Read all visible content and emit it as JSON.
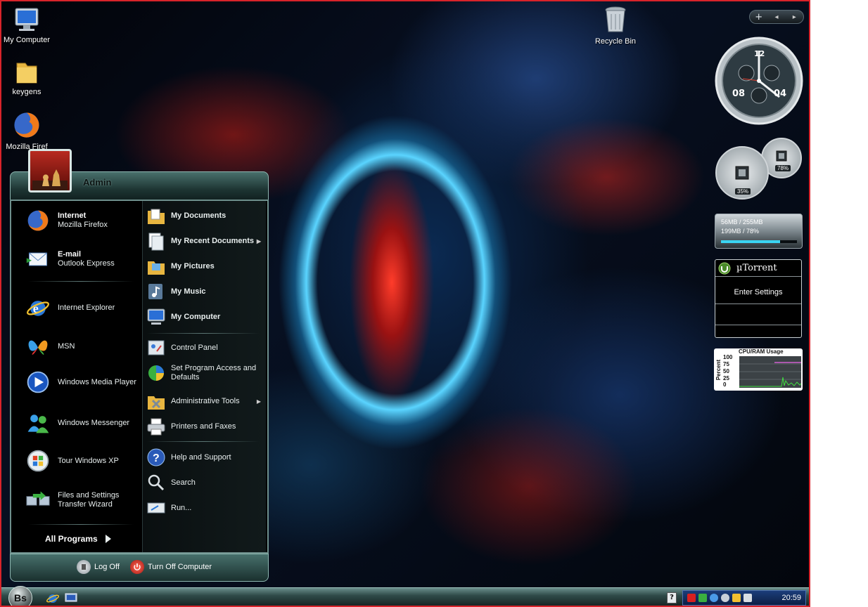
{
  "desktop": {
    "icons": [
      {
        "label": "My Computer",
        "icon": "my-computer-icon"
      },
      {
        "label": "keygens",
        "icon": "folder-icon"
      },
      {
        "label": "Mozilla Firef",
        "icon": "firefox-icon"
      },
      {
        "label": "Recycle Bin",
        "icon": "recycle-bin-icon"
      }
    ]
  },
  "start_menu": {
    "user": "Admin",
    "pinned": [
      {
        "title": "Internet",
        "subtitle": "Mozilla Firefox"
      },
      {
        "title": "E-mail",
        "subtitle": "Outlook Express"
      }
    ],
    "recent": [
      {
        "label": "Internet Explorer"
      },
      {
        "label": "MSN"
      },
      {
        "label": "Windows Media Player"
      },
      {
        "label": "Windows Messenger"
      },
      {
        "label": "Tour Windows XP"
      },
      {
        "label": "Files and Settings Transfer Wizard"
      }
    ],
    "all_programs": "All Programs",
    "right": [
      {
        "label": "My Documents"
      },
      {
        "label": "My Recent Documents"
      },
      {
        "label": "My Pictures"
      },
      {
        "label": "My Music"
      },
      {
        "label": "My Computer"
      },
      {
        "label": "Control Panel"
      },
      {
        "label": "Set Program Access and Defaults"
      },
      {
        "label": "Administrative Tools"
      },
      {
        "label": "Printers and Faxes"
      },
      {
        "label": "Help and Support"
      },
      {
        "label": "Search"
      },
      {
        "label": "Run..."
      }
    ],
    "log_off": "Log Off",
    "turn_off": "Turn Off Computer"
  },
  "taskbar": {
    "start_label": "Bs",
    "clock": "20:59",
    "help_label": "?"
  },
  "gadgets": {
    "toolbar_add": "+",
    "toolbar_prev": "◂",
    "toolbar_next": "▸",
    "clock_labels": {
      "top": "12",
      "left": "08",
      "right": "04"
    },
    "cpu_percent": "35%",
    "ram_percent": "78%",
    "memory": {
      "line1": "56MB / 255MB",
      "line2": "199MB / 78%",
      "fill": 0.78
    },
    "utorrent": {
      "title": "µTorrent",
      "action": "Enter Settings"
    },
    "cpu_graph": {
      "title": "CPU/RAM Usage",
      "ylabel": "Percent",
      "ticks": [
        "100",
        "75",
        "50",
        "25",
        "0"
      ]
    }
  },
  "colors": {
    "frame_border": "#d8232a",
    "menu_accent": "#6e8f8c",
    "tray": "#1b3d7a"
  }
}
